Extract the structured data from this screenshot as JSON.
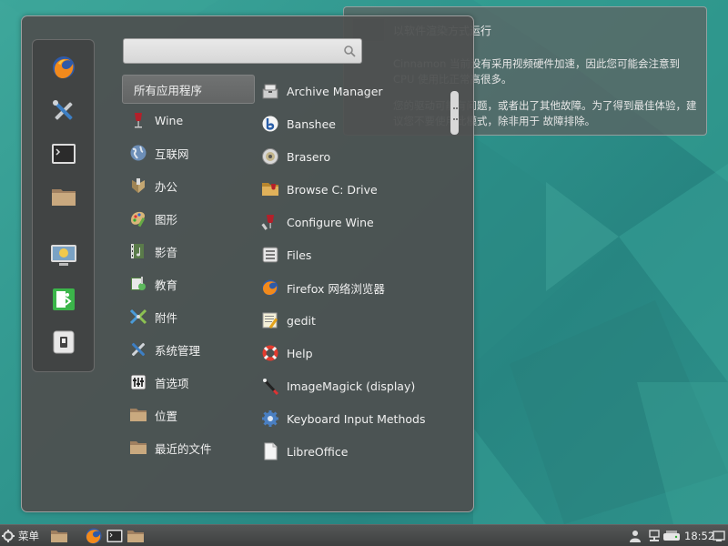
{
  "notification": {
    "title": "以软件渲染方式运行",
    "body_1": "Cinnamon 当前没有采用视频硬件加速，因此您可能会注意到 CPU 使用比正常高很多。",
    "body_2": "您的驱动可能有问题，或者出了其他故障。为了得到最佳体验，建议您不要使用此模式，除非用于 故障排除。"
  },
  "menu": {
    "search": {
      "value": "",
      "placeholder": ""
    },
    "favorites": [
      {
        "name": "Firefox",
        "icon": "firefox-icon"
      },
      {
        "name": "System Settings",
        "icon": "tools-icon"
      },
      {
        "name": "Terminal",
        "icon": "terminal-icon"
      },
      {
        "name": "Files",
        "icon": "folder-icon"
      },
      {
        "name": "Lock Screen",
        "icon": "lock-screen-icon"
      },
      {
        "name": "Log Out",
        "icon": "logout-icon"
      },
      {
        "name": "Shut Down",
        "icon": "power-icon"
      }
    ],
    "categories": [
      {
        "label": "所有应用程序",
        "icon": "",
        "selected": true
      },
      {
        "label": "Wine",
        "icon": "wine-icon"
      },
      {
        "label": "互联网",
        "icon": "globe-icon"
      },
      {
        "label": "办公",
        "icon": "office-icon"
      },
      {
        "label": "图形",
        "icon": "graphics-icon"
      },
      {
        "label": "影音",
        "icon": "multimedia-icon"
      },
      {
        "label": "教育",
        "icon": "education-icon"
      },
      {
        "label": "附件",
        "icon": "accessories-icon"
      },
      {
        "label": "系统管理",
        "icon": "tools-icon"
      },
      {
        "label": "首选项",
        "icon": "preferences-icon"
      },
      {
        "label": "位置",
        "icon": "folder-icon"
      },
      {
        "label": "最近的文件",
        "icon": "folder-icon"
      }
    ],
    "apps": [
      {
        "label": "Archive Manager",
        "icon": "archive-icon"
      },
      {
        "label": "Banshee",
        "icon": "banshee-icon"
      },
      {
        "label": "Brasero",
        "icon": "disc-icon"
      },
      {
        "label": "Browse C: Drive",
        "icon": "wine-folder-icon"
      },
      {
        "label": "Configure Wine",
        "icon": "wine-config-icon"
      },
      {
        "label": "Files",
        "icon": "files-icon"
      },
      {
        "label": "Firefox 网络浏览器",
        "icon": "firefox-icon"
      },
      {
        "label": "gedit",
        "icon": "gedit-icon"
      },
      {
        "label": "Help",
        "icon": "help-icon"
      },
      {
        "label": "ImageMagick (display)",
        "icon": "imagemagick-icon"
      },
      {
        "label": "Keyboard Input Methods",
        "icon": "gear-icon"
      },
      {
        "label": "LibreOffice",
        "icon": "document-icon"
      }
    ]
  },
  "panel": {
    "menu_label": "菜单",
    "clock": "18:52"
  },
  "colors": {
    "desktop": "#2f958d",
    "menu_bg": "#4e5050",
    "panel_bg": "#484a4a"
  }
}
